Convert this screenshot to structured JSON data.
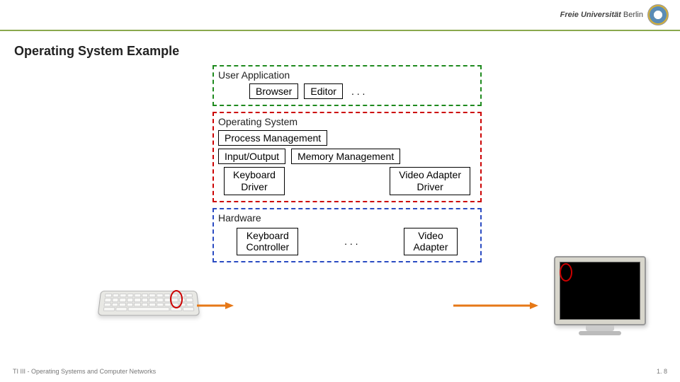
{
  "header": {
    "uni_prefix": "Freie Universität",
    "uni_city": "Berlin"
  },
  "title": "Operating System Example",
  "layers": {
    "ua": {
      "title": "User Application",
      "browser": "Browser",
      "editor": "Editor",
      "ell": ". . ."
    },
    "os": {
      "title": "Operating System",
      "pm": "Process Management",
      "io": "Input/Output",
      "mm": "Memory Management",
      "kbd_drv": "Keyboard\nDriver",
      "vid_drv": "Video Adapter\nDriver"
    },
    "hw": {
      "title": "Hardware",
      "kbd_ctrl": "Keyboard\nController",
      "ell": ". . .",
      "vid_ad": "Video\nAdapter"
    }
  },
  "footer": {
    "left": "TI III - Operating Systems and Computer Networks",
    "right": "1. 8"
  }
}
